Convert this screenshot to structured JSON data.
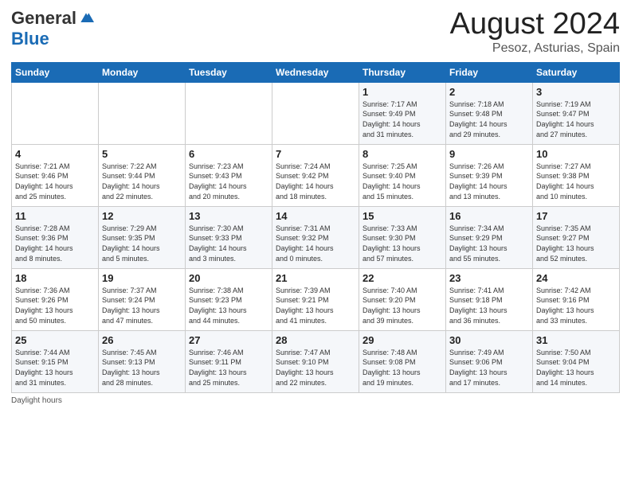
{
  "logo": {
    "general": "General",
    "blue": "Blue"
  },
  "header": {
    "month_year": "August 2024",
    "location": "Pesoz, Asturias, Spain"
  },
  "days_of_week": [
    "Sunday",
    "Monday",
    "Tuesday",
    "Wednesday",
    "Thursday",
    "Friday",
    "Saturday"
  ],
  "weeks": [
    [
      {
        "day": "",
        "info": ""
      },
      {
        "day": "",
        "info": ""
      },
      {
        "day": "",
        "info": ""
      },
      {
        "day": "",
        "info": ""
      },
      {
        "day": "1",
        "info": "Sunrise: 7:17 AM\nSunset: 9:49 PM\nDaylight: 14 hours\nand 31 minutes."
      },
      {
        "day": "2",
        "info": "Sunrise: 7:18 AM\nSunset: 9:48 PM\nDaylight: 14 hours\nand 29 minutes."
      },
      {
        "day": "3",
        "info": "Sunrise: 7:19 AM\nSunset: 9:47 PM\nDaylight: 14 hours\nand 27 minutes."
      }
    ],
    [
      {
        "day": "4",
        "info": "Sunrise: 7:21 AM\nSunset: 9:46 PM\nDaylight: 14 hours\nand 25 minutes."
      },
      {
        "day": "5",
        "info": "Sunrise: 7:22 AM\nSunset: 9:44 PM\nDaylight: 14 hours\nand 22 minutes."
      },
      {
        "day": "6",
        "info": "Sunrise: 7:23 AM\nSunset: 9:43 PM\nDaylight: 14 hours\nand 20 minutes."
      },
      {
        "day": "7",
        "info": "Sunrise: 7:24 AM\nSunset: 9:42 PM\nDaylight: 14 hours\nand 18 minutes."
      },
      {
        "day": "8",
        "info": "Sunrise: 7:25 AM\nSunset: 9:40 PM\nDaylight: 14 hours\nand 15 minutes."
      },
      {
        "day": "9",
        "info": "Sunrise: 7:26 AM\nSunset: 9:39 PM\nDaylight: 14 hours\nand 13 minutes."
      },
      {
        "day": "10",
        "info": "Sunrise: 7:27 AM\nSunset: 9:38 PM\nDaylight: 14 hours\nand 10 minutes."
      }
    ],
    [
      {
        "day": "11",
        "info": "Sunrise: 7:28 AM\nSunset: 9:36 PM\nDaylight: 14 hours\nand 8 minutes."
      },
      {
        "day": "12",
        "info": "Sunrise: 7:29 AM\nSunset: 9:35 PM\nDaylight: 14 hours\nand 5 minutes."
      },
      {
        "day": "13",
        "info": "Sunrise: 7:30 AM\nSunset: 9:33 PM\nDaylight: 14 hours\nand 3 minutes."
      },
      {
        "day": "14",
        "info": "Sunrise: 7:31 AM\nSunset: 9:32 PM\nDaylight: 14 hours\nand 0 minutes."
      },
      {
        "day": "15",
        "info": "Sunrise: 7:33 AM\nSunset: 9:30 PM\nDaylight: 13 hours\nand 57 minutes."
      },
      {
        "day": "16",
        "info": "Sunrise: 7:34 AM\nSunset: 9:29 PM\nDaylight: 13 hours\nand 55 minutes."
      },
      {
        "day": "17",
        "info": "Sunrise: 7:35 AM\nSunset: 9:27 PM\nDaylight: 13 hours\nand 52 minutes."
      }
    ],
    [
      {
        "day": "18",
        "info": "Sunrise: 7:36 AM\nSunset: 9:26 PM\nDaylight: 13 hours\nand 50 minutes."
      },
      {
        "day": "19",
        "info": "Sunrise: 7:37 AM\nSunset: 9:24 PM\nDaylight: 13 hours\nand 47 minutes."
      },
      {
        "day": "20",
        "info": "Sunrise: 7:38 AM\nSunset: 9:23 PM\nDaylight: 13 hours\nand 44 minutes."
      },
      {
        "day": "21",
        "info": "Sunrise: 7:39 AM\nSunset: 9:21 PM\nDaylight: 13 hours\nand 41 minutes."
      },
      {
        "day": "22",
        "info": "Sunrise: 7:40 AM\nSunset: 9:20 PM\nDaylight: 13 hours\nand 39 minutes."
      },
      {
        "day": "23",
        "info": "Sunrise: 7:41 AM\nSunset: 9:18 PM\nDaylight: 13 hours\nand 36 minutes."
      },
      {
        "day": "24",
        "info": "Sunrise: 7:42 AM\nSunset: 9:16 PM\nDaylight: 13 hours\nand 33 minutes."
      }
    ],
    [
      {
        "day": "25",
        "info": "Sunrise: 7:44 AM\nSunset: 9:15 PM\nDaylight: 13 hours\nand 31 minutes."
      },
      {
        "day": "26",
        "info": "Sunrise: 7:45 AM\nSunset: 9:13 PM\nDaylight: 13 hours\nand 28 minutes."
      },
      {
        "day": "27",
        "info": "Sunrise: 7:46 AM\nSunset: 9:11 PM\nDaylight: 13 hours\nand 25 minutes."
      },
      {
        "day": "28",
        "info": "Sunrise: 7:47 AM\nSunset: 9:10 PM\nDaylight: 13 hours\nand 22 minutes."
      },
      {
        "day": "29",
        "info": "Sunrise: 7:48 AM\nSunset: 9:08 PM\nDaylight: 13 hours\nand 19 minutes."
      },
      {
        "day": "30",
        "info": "Sunrise: 7:49 AM\nSunset: 9:06 PM\nDaylight: 13 hours\nand 17 minutes."
      },
      {
        "day": "31",
        "info": "Sunrise: 7:50 AM\nSunset: 9:04 PM\nDaylight: 13 hours\nand 14 minutes."
      }
    ]
  ],
  "footer": {
    "note": "Daylight hours"
  }
}
